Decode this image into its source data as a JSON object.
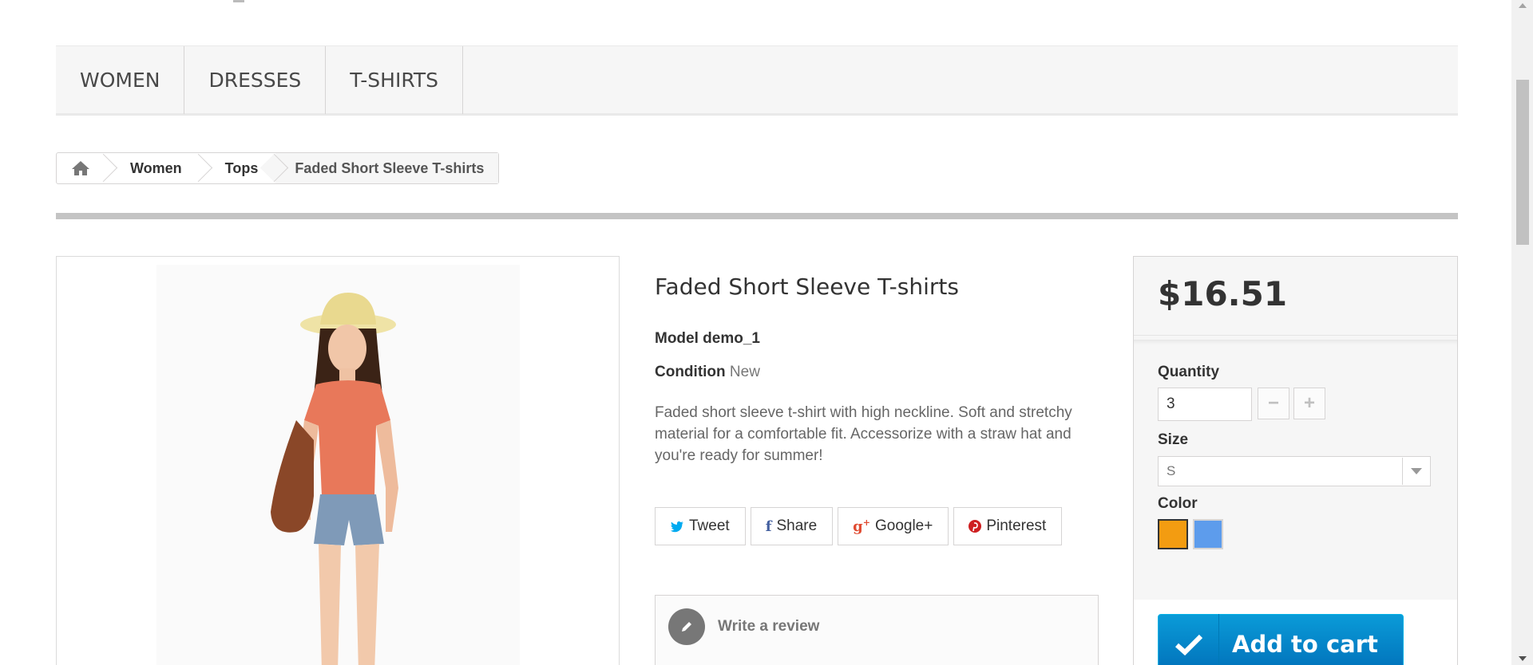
{
  "nav": {
    "items": [
      {
        "label": "WOMEN"
      },
      {
        "label": "DRESSES"
      },
      {
        "label": "T-SHIRTS"
      }
    ]
  },
  "breadcrumb": {
    "home_icon": "home-icon",
    "items": [
      "Women",
      "Tops"
    ],
    "current": "Faded Short Sleeve T-shirts"
  },
  "product": {
    "title": "Faded Short Sleeve T-shirts",
    "model_label": "Model demo_1",
    "condition_label": "Condition",
    "condition_value": "New",
    "description": "Faded short sleeve t-shirt with high neckline. Soft and stretchy material for a comfortable fit. Accessorize with a straw hat and you're ready for summer!"
  },
  "social": {
    "tweet": "Tweet",
    "share": "Share",
    "google": "Google+",
    "pinterest": "Pinterest"
  },
  "review": {
    "label": "Write a review"
  },
  "buy": {
    "price": "$16.51",
    "quantity_label": "Quantity",
    "quantity_value": "3",
    "size_label": "Size",
    "size_value": "S",
    "color_label": "Color",
    "colors": [
      "#f39c11",
      "#5d9cec"
    ],
    "selected_color": "#f39c11",
    "add_to_cart": "Add to cart"
  },
  "colors": {
    "accent": "#0a9bd8",
    "twitter": "#00aaf0",
    "facebook": "#435f9f",
    "google": "#e04b31",
    "pinterest": "#ce1f21"
  }
}
